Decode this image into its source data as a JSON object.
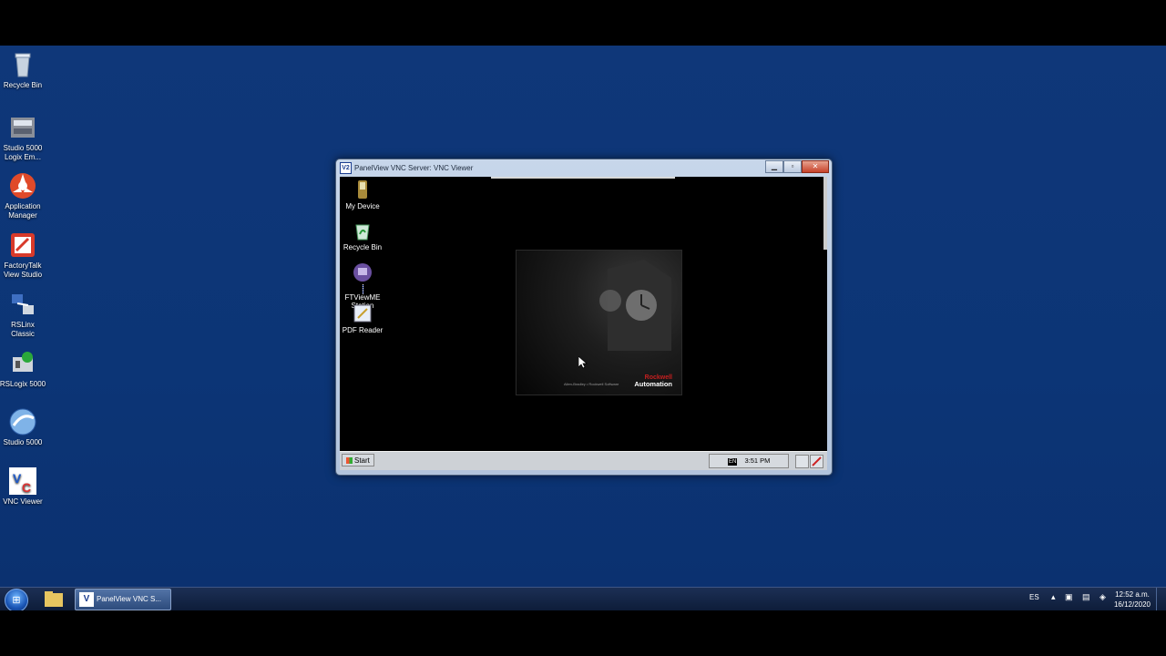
{
  "desktop": {
    "icons": [
      {
        "label_1": "Recycle Bin",
        "label_2": "",
        "icon": "recycle-bin-icon"
      },
      {
        "label_1": "Studio 5000",
        "label_2": "Logix Em...",
        "icon": "studio5000-emulate-icon"
      },
      {
        "label_1": "Application",
        "label_2": "Manager",
        "icon": "application-manager-icon"
      },
      {
        "label_1": "FactoryTalk",
        "label_2": "View Studio",
        "icon": "factorytalk-view-icon"
      },
      {
        "label_1": "RSLinx",
        "label_2": "Classic",
        "icon": "rslinx-icon"
      },
      {
        "label_1": "RSLogix 5000",
        "label_2": "",
        "icon": "rslogix-icon"
      },
      {
        "label_1": "Studio 5000",
        "label_2": "",
        "icon": "studio5000-icon"
      },
      {
        "label_1": "VNC Viewer",
        "label_2": "",
        "icon": "vnc-viewer-icon"
      }
    ]
  },
  "vnc_window": {
    "title": "PanelView VNC Server: VNC Viewer",
    "title_icon_text": "V2",
    "remote": {
      "icons": [
        {
          "label_1": "My Device",
          "label_2": "",
          "selected": false
        },
        {
          "label_1": "Recycle Bin",
          "label_2": "",
          "selected": false
        },
        {
          "label_1": "FTViewME",
          "label_2": "Station",
          "selected": true
        },
        {
          "label_1": "PDF Reader",
          "label_2": "",
          "selected": false
        }
      ],
      "splash": {
        "brand_1": "Rockwell",
        "brand_2": "Automation",
        "allen_bradley": "Allen-Bradley • Rockwell Software"
      },
      "taskbar": {
        "start_label": "Start",
        "lang": "EN",
        "time": "3:51 PM"
      }
    }
  },
  "taskbar": {
    "task_label": "PanelView VNC S...",
    "lang": "ES",
    "time": "12:52 a.m.",
    "date": "16/12/2020"
  }
}
